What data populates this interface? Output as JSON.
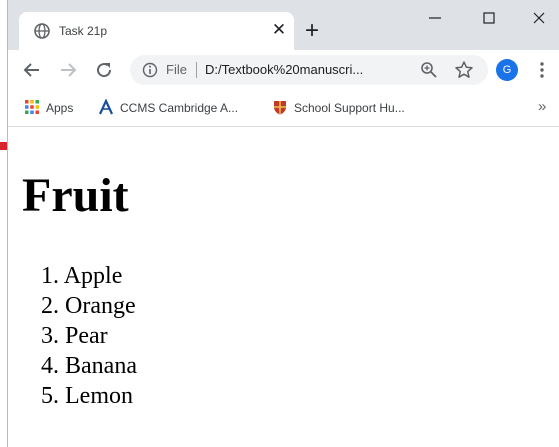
{
  "browser": {
    "tab": {
      "title": "Task 21p",
      "favicon": "globe-icon"
    },
    "address_bar": {
      "scheme_label": "File",
      "url": "D:/Textbook%20manuscri..."
    },
    "profile_initial": "G",
    "bookmarks": [
      {
        "label": "Apps",
        "icon": "apps-grid-icon"
      },
      {
        "label": "CCMS Cambridge A...",
        "icon": "ccms-icon"
      },
      {
        "label": "School Support Hu...",
        "icon": "shield-crest-icon"
      }
    ],
    "bookmarks_more": "»"
  },
  "page": {
    "heading": "Fruit",
    "list": [
      {
        "num": "1.",
        "text": "Apple"
      },
      {
        "num": "2.",
        "text": "Orange"
      },
      {
        "num": "3.",
        "text": "Pear"
      },
      {
        "num": "4.",
        "text": "Banana"
      },
      {
        "num": "5.",
        "text": "Lemon"
      }
    ]
  },
  "colors": {
    "title_bar": "#dee1e6",
    "omnibox": "#f1f3f4",
    "avatar": "#1a73e8",
    "callout_arrow": "#d9262c"
  }
}
